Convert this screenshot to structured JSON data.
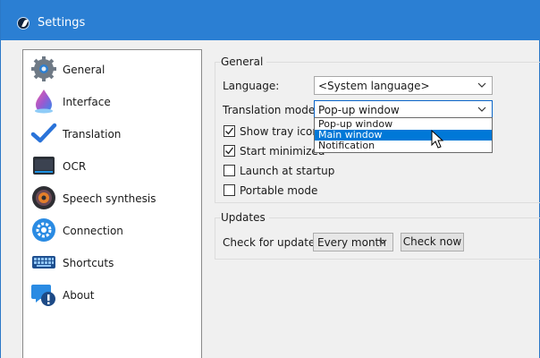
{
  "window": {
    "title": "Settings"
  },
  "sidebar": {
    "items": [
      {
        "label": "General",
        "icon": "gear-icon"
      },
      {
        "label": "Interface",
        "icon": "paint-drop-icon"
      },
      {
        "label": "Translation",
        "icon": "checkmark-icon"
      },
      {
        "label": "OCR",
        "icon": "scanner-icon"
      },
      {
        "label": "Speech synthesis",
        "icon": "speaker-icon"
      },
      {
        "label": "Connection",
        "icon": "settings-circle-icon"
      },
      {
        "label": "Shortcuts",
        "icon": "keyboard-icon"
      },
      {
        "label": "About",
        "icon": "info-chat-icon"
      }
    ]
  },
  "general": {
    "title": "General",
    "language_label": "Language:",
    "language_value": "<System language>",
    "translation_mode_label": "Translation mode:",
    "translation_mode_value": "Pop-up window",
    "translation_mode_options": [
      "Pop-up window",
      "Main window",
      "Notification"
    ],
    "translation_mode_highlighted": "Main window",
    "checkboxes": [
      {
        "label": "Show tray icon",
        "checked": true
      },
      {
        "label": "Start minimized",
        "checked": true
      },
      {
        "label": "Launch at startup",
        "checked": false
      },
      {
        "label": "Portable mode",
        "checked": false
      }
    ]
  },
  "updates": {
    "title": "Updates",
    "check_label": "Check for updates:",
    "frequency_value": "Every month",
    "check_now_label": "Check now"
  },
  "colors": {
    "titlebar": "#2b7fd3",
    "selection": "#0078d7",
    "window_bg": "#f0f0f0"
  }
}
